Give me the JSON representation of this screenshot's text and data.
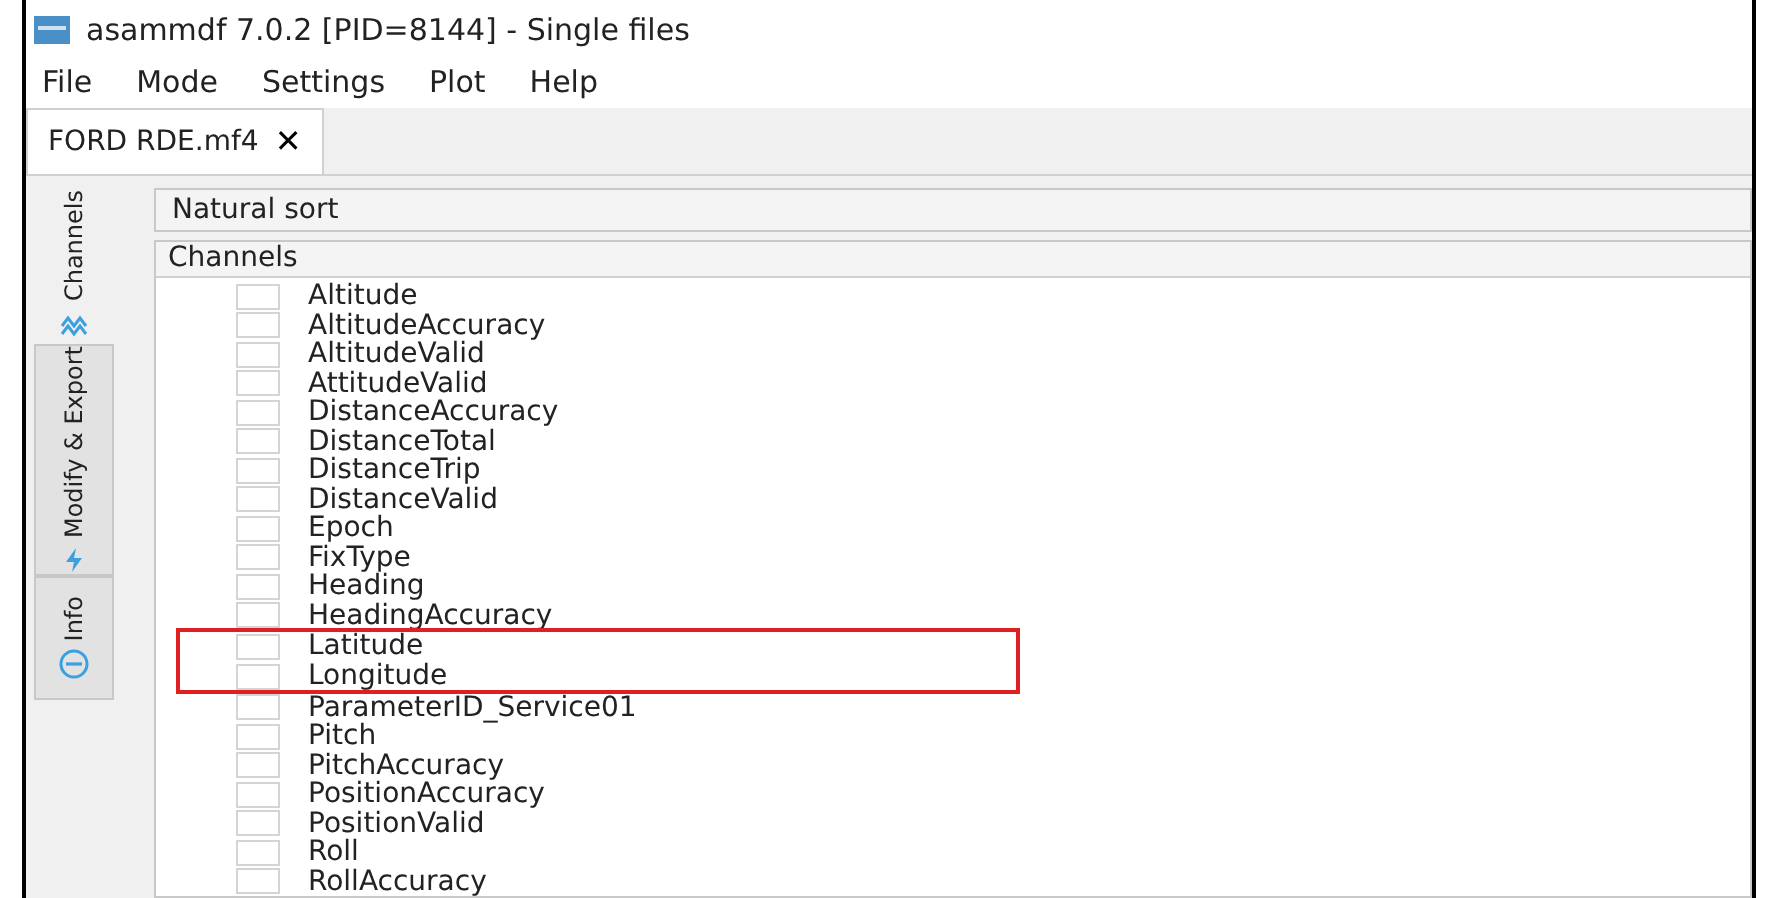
{
  "window": {
    "title": "asammdf 7.0.2 [PID=8144] - Single files"
  },
  "menu": [
    "File",
    "Mode",
    "Settings",
    "Plot",
    "Help"
  ],
  "file_tabs": [
    {
      "label": "FORD RDE.mf4",
      "selected": true,
      "close": "✕"
    }
  ],
  "side_tabs": [
    {
      "label": "Channels",
      "kind": "channels",
      "selected": true
    },
    {
      "label": "Modify & Export",
      "kind": "modify",
      "selected": false
    },
    {
      "label": "Info",
      "kind": "info",
      "selected": false
    }
  ],
  "sort_combo": {
    "value": "Natural sort"
  },
  "channels": {
    "header": "Channels",
    "items": [
      {
        "name": "Altitude",
        "checked": false,
        "highlighted": false
      },
      {
        "name": "AltitudeAccuracy",
        "checked": false,
        "highlighted": false
      },
      {
        "name": "AltitudeValid",
        "checked": false,
        "highlighted": false
      },
      {
        "name": "AttitudeValid",
        "checked": false,
        "highlighted": false
      },
      {
        "name": "DistanceAccuracy",
        "checked": false,
        "highlighted": false
      },
      {
        "name": "DistanceTotal",
        "checked": false,
        "highlighted": false
      },
      {
        "name": "DistanceTrip",
        "checked": false,
        "highlighted": false
      },
      {
        "name": "DistanceValid",
        "checked": false,
        "highlighted": false
      },
      {
        "name": "Epoch",
        "checked": false,
        "highlighted": false
      },
      {
        "name": "FixType",
        "checked": false,
        "highlighted": false
      },
      {
        "name": "Heading",
        "checked": false,
        "highlighted": false
      },
      {
        "name": "HeadingAccuracy",
        "checked": false,
        "highlighted": false
      },
      {
        "name": "Latitude",
        "checked": false,
        "highlighted": true
      },
      {
        "name": "Longitude",
        "checked": false,
        "highlighted": true
      },
      {
        "name": "ParameterID_Service01",
        "checked": false,
        "highlighted": false
      },
      {
        "name": "Pitch",
        "checked": false,
        "highlighted": false
      },
      {
        "name": "PitchAccuracy",
        "checked": false,
        "highlighted": false
      },
      {
        "name": "PositionAccuracy",
        "checked": false,
        "highlighted": false
      },
      {
        "name": "PositionValid",
        "checked": false,
        "highlighted": false
      },
      {
        "name": "Roll",
        "checked": false,
        "highlighted": false
      },
      {
        "name": "RollAccuracy",
        "checked": false,
        "highlighted": false
      }
    ]
  }
}
